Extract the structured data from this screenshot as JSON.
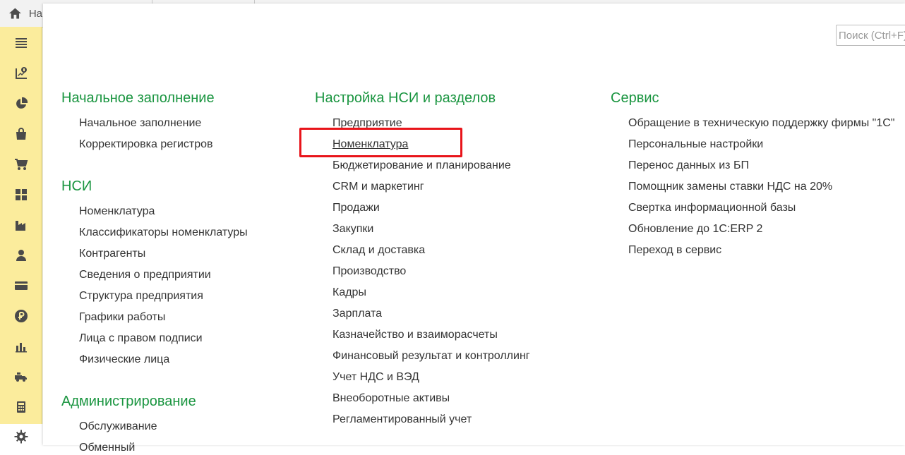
{
  "topbar": {
    "home_label": "На"
  },
  "search": {
    "placeholder": "Поиск (Ctrl+F)"
  },
  "sidebar": {
    "items": [
      {
        "icon": "menu-icon"
      },
      {
        "icon": "cash-flow-icon"
      },
      {
        "icon": "pie-chart-icon"
      },
      {
        "icon": "shopping-bag-icon"
      },
      {
        "icon": "cart-icon"
      },
      {
        "icon": "warehouse-grid-icon"
      },
      {
        "icon": "factory-icon"
      },
      {
        "icon": "person-icon"
      },
      {
        "icon": "card-icon"
      },
      {
        "icon": "ruble-icon"
      },
      {
        "icon": "bar-chart-icon"
      },
      {
        "icon": "truck-icon"
      },
      {
        "icon": "calculator-icon"
      },
      {
        "icon": "gear-icon"
      }
    ]
  },
  "sections": {
    "initial": {
      "title": "Начальное заполнение",
      "items": [
        "Начальное заполнение",
        "Корректировка регистров"
      ]
    },
    "nsi": {
      "title": "НСИ",
      "items": [
        "Номенклатура",
        "Классификаторы номенклатуры",
        "Контрагенты",
        "Сведения о предприятии",
        "Структура предприятия",
        "Графики работы",
        "Лица с правом подписи",
        "Физические лица"
      ]
    },
    "admin": {
      "title": "Администрирование",
      "items": [
        "Обслуживание",
        "Обменный"
      ]
    },
    "settings": {
      "title": "Настройка НСИ и разделов",
      "items": [
        "Предприятие",
        "Номенклатура",
        "Бюджетирование и планирование",
        "CRM и маркетинг",
        "Продажи",
        "Закупки",
        "Склад и доставка",
        "Производство",
        "Кадры",
        "Зарплата",
        "Казначейство и взаиморасчеты",
        "Финансовый результат и контроллинг",
        "Учет НДС и ВЭД",
        "Внеоборотные активы",
        "Регламентированный учет"
      ]
    },
    "service": {
      "title": "Сервис",
      "items": [
        "Обращение в техническую поддержку фирмы \"1С\"",
        "Персональные настройки",
        "Перенос данных из БП",
        "Помощник замены ставки НДС на 20%",
        "Свертка информационной базы",
        "Обновление до 1С:ERP 2",
        "Переход в сервис"
      ]
    }
  },
  "colors": {
    "section_title": "#1a9540",
    "sidebar_bg": "#fbec9c",
    "highlight": "#e8141a"
  }
}
